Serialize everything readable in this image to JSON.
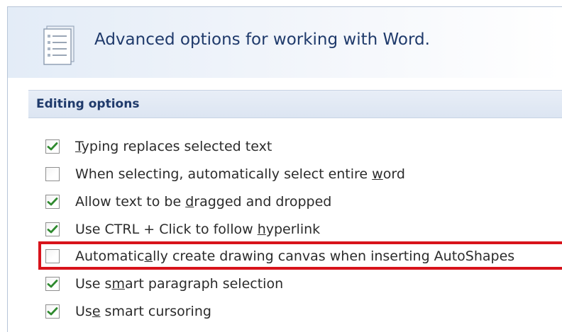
{
  "header": {
    "title": "Advanced options for working with Word.",
    "icon": "document-list-icon"
  },
  "section": {
    "title": "Editing options"
  },
  "options": [
    {
      "id": "typing-replaces",
      "pre": "",
      "key": "T",
      "post": "yping replaces selected text",
      "checked": true
    },
    {
      "id": "select-entire-word",
      "pre": "When selecting, automatically select entire ",
      "key": "w",
      "post": "ord",
      "checked": false
    },
    {
      "id": "drag-drop",
      "pre": "Allow text to be ",
      "key": "d",
      "post": "ragged and dropped",
      "checked": true
    },
    {
      "id": "ctrl-click-hyperlink",
      "pre": "Use CTRL + Click to follow ",
      "key": "h",
      "post": "yperlink",
      "checked": true
    },
    {
      "id": "drawing-canvas",
      "pre": "Automatic",
      "key": "a",
      "post": "lly create drawing canvas when inserting AutoShapes",
      "checked": false,
      "highlighted": true
    },
    {
      "id": "smart-paragraph",
      "pre": "Use s",
      "key": "m",
      "post": "art paragraph selection",
      "checked": true
    },
    {
      "id": "smart-cursoring",
      "pre": "Us",
      "key": "e",
      "post": " smart cursoring",
      "checked": true
    }
  ],
  "colors": {
    "checkmark": "#2f8a2f",
    "highlight": "#d8131b",
    "title": "#1f3a6b"
  }
}
